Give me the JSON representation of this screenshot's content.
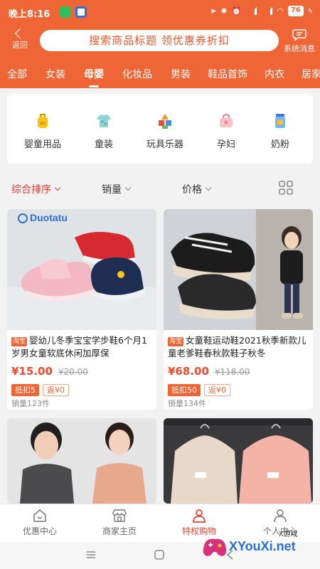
{
  "status_bar": {
    "time": "晚上8:16",
    "battery": "76"
  },
  "header": {
    "back_label": "返回",
    "search_placeholder": "搜索商品标题 领优惠券折扣",
    "message_label": "系统消息"
  },
  "categories": [
    "全部",
    "女装",
    "母婴",
    "化妆品",
    "男装",
    "鞋品首饰",
    "内衣",
    "居家"
  ],
  "active_category": "母婴",
  "sub_categories": [
    {
      "label": "婴童用品",
      "icon": "backpack-icon"
    },
    {
      "label": "童装",
      "icon": "kids-clothing-icon"
    },
    {
      "label": "玩具乐器",
      "icon": "toy-blocks-icon"
    },
    {
      "label": "孕妇",
      "icon": "maternity-bag-icon"
    },
    {
      "label": "奶粉",
      "icon": "milk-powder-icon"
    }
  ],
  "sort_bar": {
    "comprehensive": "综合排序",
    "sales": "销量",
    "price": "价格"
  },
  "products": [
    {
      "brand": "Duotatu",
      "platform_tag": "淘宝",
      "title": "婴幼儿冬季宝宝学步鞋6个月1岁男女童软底休闲加厚保",
      "price": "¥15.00",
      "original_price": "¥20.00",
      "coupon": "抵扣5",
      "rebate": "返¥0",
      "sales": "销量123件"
    },
    {
      "platform_tag": "淘宝",
      "title": "女童鞋运动鞋2021秋季新款儿童老爹鞋春秋款鞋子秋冬",
      "price": "¥68.00",
      "original_price": "¥118.00",
      "coupon": "抵扣50",
      "rebate": "返¥0",
      "sales": "销量134件"
    }
  ],
  "bottom_nav": [
    "优惠中心",
    "商家主页",
    "特权购物",
    "个人中心"
  ],
  "active_nav": "特权购物",
  "watermark": {
    "text": "XYouXi.net",
    "small": "X游戏"
  },
  "colors": {
    "brand": "#f06535",
    "price": "#f04a32",
    "active_nav": "#e0453a"
  }
}
